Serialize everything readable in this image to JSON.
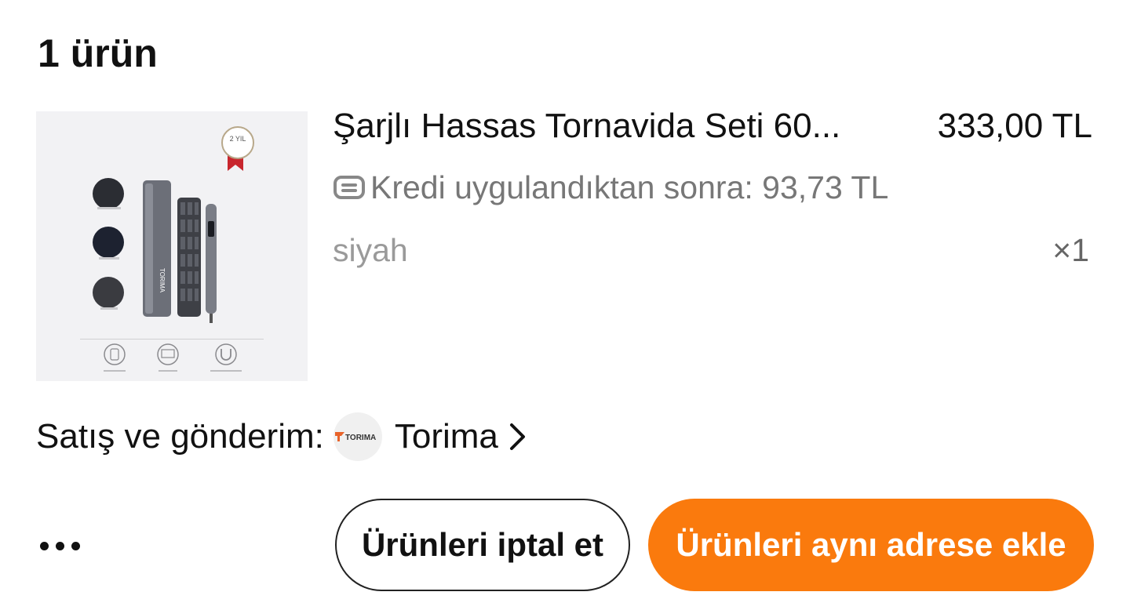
{
  "order": {
    "item_count_label": "1 ürün"
  },
  "product": {
    "name": "Şarjlı Hassas Tornavida Seti 60...",
    "price": "333,00 TL",
    "credit_text": "Kredi uygulandıktan sonra: 93,73 TL",
    "variant": "siyah",
    "quantity": "×1",
    "image_badge_text": "2 YIL",
    "image_brand_text": "TORIMA"
  },
  "seller": {
    "label": "Satış ve gönderim:",
    "name": "Torima",
    "logo_text": "TORIMA"
  },
  "actions": {
    "cancel_label": "Ürünleri iptal et",
    "add_label": "Ürünleri aynı adrese ekle"
  },
  "colors": {
    "accent": "#fa7a0d",
    "muted_text": "#777777"
  },
  "icons": {
    "credit": "credit-card-icon",
    "chevron": "chevron-right-icon",
    "more": "more-horizontal-icon"
  }
}
